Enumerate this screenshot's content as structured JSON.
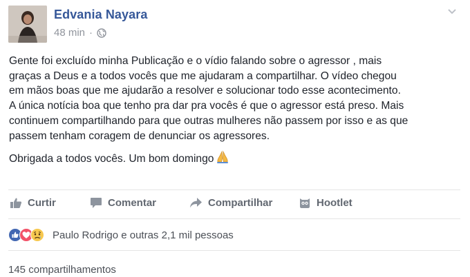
{
  "post": {
    "author": "Edvania Nayara",
    "time": "48 min",
    "separator": "·",
    "privacy_icon": "globe-icon",
    "lines": [
      "Gente foi excluído minha Publicação e o vídio falando sobre o agressor , mais",
      "graças a Deus e a todos vocês que me ajudaram a compartilhar. O vídeo chegou",
      "em mãos boas que me ajudarão a resolver e solucionar todo esse acontecimento.",
      "A única notícia boa que tenho pra dar pra vocês é que o agressor está preso. Mais",
      "continuem compartilhando para que outras mulheres não passem por isso e as que",
      "passem tenham coragem de denunciar os agressores."
    ],
    "closing": "Obrigada a todos vocês. Um bom domingo"
  },
  "actions": {
    "like": "Curtir",
    "comment": "Comentar",
    "share": "Compartilhar",
    "hootlet": "Hootlet"
  },
  "reactions": {
    "icons": [
      "like-reaction-icon",
      "love-reaction-icon",
      "sad-reaction-icon"
    ],
    "summary": "Paulo Rodrigo e outras 2,1 mil pessoas"
  },
  "shares": {
    "label": "145 compartilhamentos"
  },
  "colors": {
    "author": "#365899",
    "action": "#616770",
    "like_blue": "#4267b2",
    "love_red": "#f25268",
    "sad_yellow": "#f7c84f"
  }
}
